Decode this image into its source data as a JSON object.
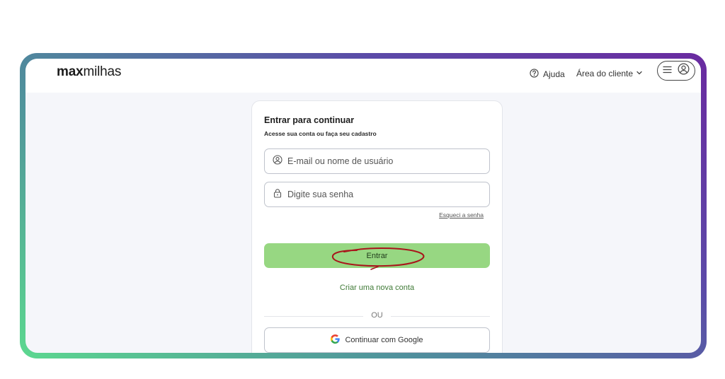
{
  "header": {
    "logo_bold": "max",
    "logo_light": "milhas",
    "help_label": "Ajuda",
    "client_area_label": "Área do cliente"
  },
  "login": {
    "title": "Entrar para continuar",
    "subtitle": "Acesse sua conta ou faça seu cadastro",
    "email_placeholder": "E-mail ou nome de usuário",
    "password_placeholder": "Digite sua senha",
    "forgot_password": "Esqueci a senha",
    "submit_label": "Entrar",
    "create_account": "Criar uma nova conta",
    "divider_text": "OU",
    "google_label": "Continuar com Google"
  },
  "colors": {
    "primary_button": "#97d782",
    "link_green": "#3f7a36",
    "annotation_ring": "#a8161b"
  },
  "icons": [
    "help-circle-icon",
    "chevron-down-icon",
    "menu-icon",
    "user-circle-icon",
    "user-icon",
    "lock-icon",
    "google-icon"
  ]
}
